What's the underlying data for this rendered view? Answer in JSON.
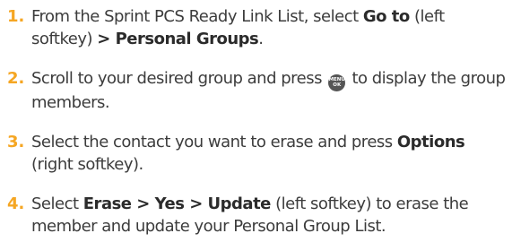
{
  "steps": [
    {
      "number": "1.",
      "t1": "From the Sprint PCS Ready Link List, select ",
      "b1": "Go to",
      "t2": " (left softkey) ",
      "b2": "> Personal Groups",
      "t3": "."
    },
    {
      "number": "2.",
      "t1": "Scroll to your desired group and press ",
      "icon": "menu-ok-key-icon",
      "icon_top": "MENU",
      "icon_bottom": "OK",
      "t2": " to display the group members."
    },
    {
      "number": "3.",
      "t1": "Select the contact you want to erase and press ",
      "b1": "Options",
      "t2": " (right softkey)."
    },
    {
      "number": "4.",
      "t1": "Select ",
      "b1": "Erase > Yes > Update",
      "t2": " (left softkey) to erase the member and update your Personal Group List."
    }
  ]
}
